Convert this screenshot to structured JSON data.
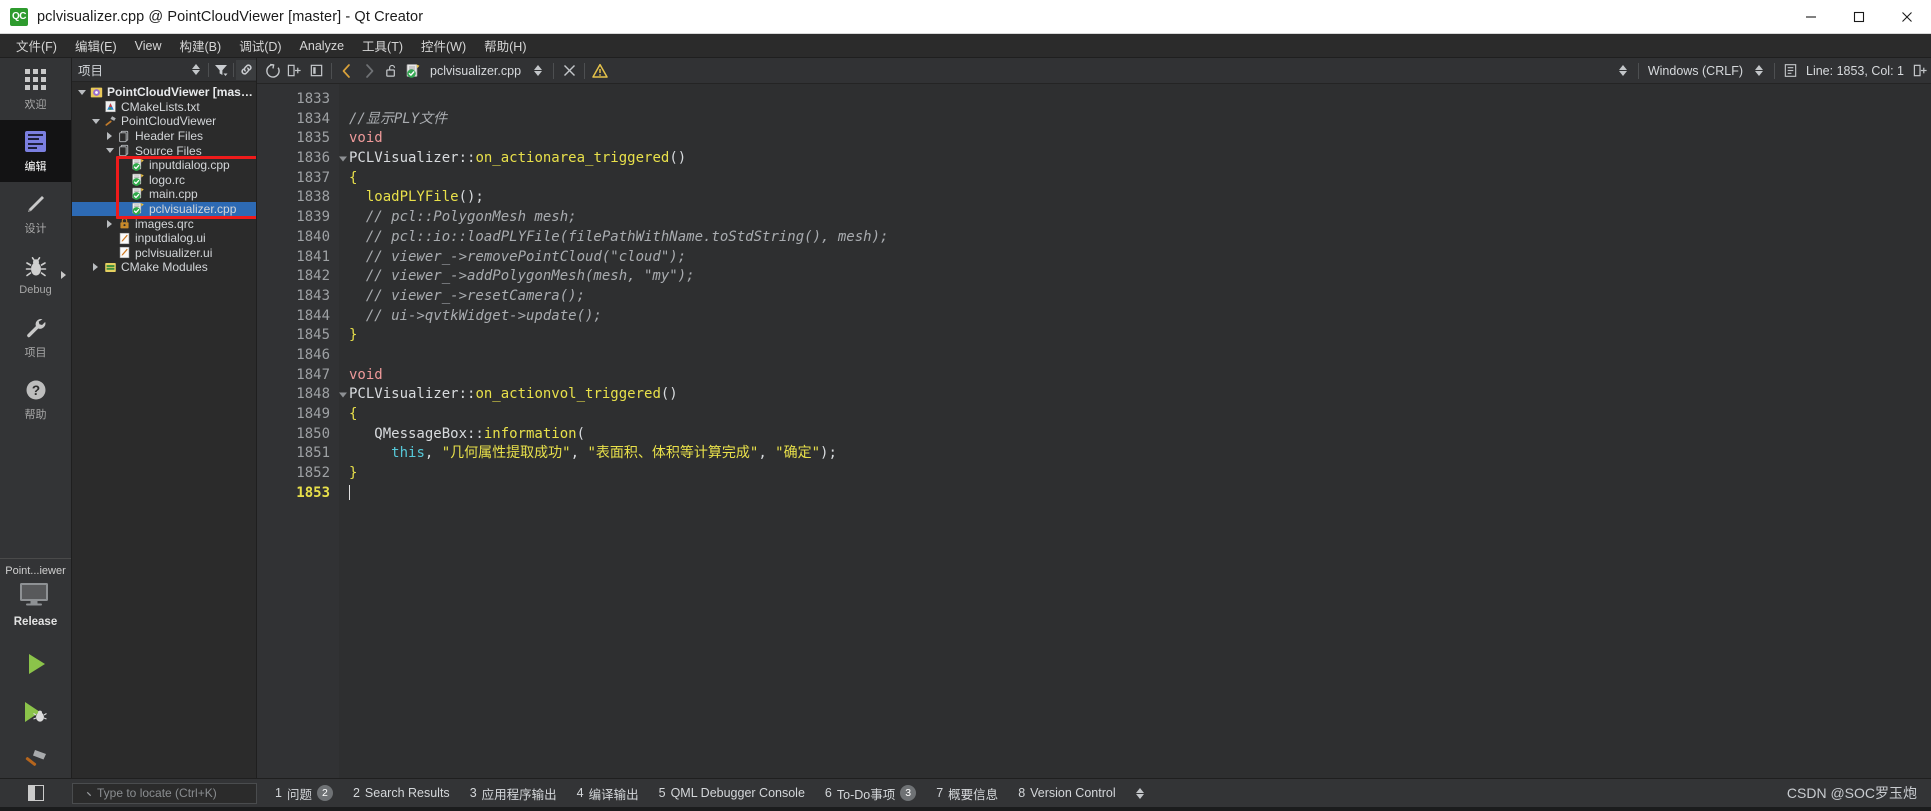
{
  "window": {
    "title": "pclvisualizer.cpp @ PointCloudViewer [master] - Qt Creator",
    "logo_text": "QC",
    "minimize_label": "Minimize",
    "maximize_label": "Maximize",
    "close_label": "Close"
  },
  "menubar": {
    "items": [
      {
        "label": "文件(F)"
      },
      {
        "label": "编辑(E)"
      },
      {
        "label": "View"
      },
      {
        "label": "构建(B)"
      },
      {
        "label": "调试(D)"
      },
      {
        "label": "Analyze"
      },
      {
        "label": "工具(T)"
      },
      {
        "label": "控件(W)"
      },
      {
        "label": "帮助(H)"
      }
    ]
  },
  "modebar": {
    "modes": [
      {
        "label": "欢迎",
        "icon": "grid-icon",
        "active": false,
        "has_arrow": false
      },
      {
        "label": "编辑",
        "icon": "edit-icon",
        "active": true,
        "has_arrow": false
      },
      {
        "label": "设计",
        "icon": "design-pencil-icon",
        "active": false,
        "has_arrow": false
      },
      {
        "label": "Debug",
        "icon": "bug-icon",
        "active": false,
        "has_arrow": true
      },
      {
        "label": "项目",
        "icon": "wrench-icon",
        "active": false,
        "has_arrow": false
      },
      {
        "label": "帮助",
        "icon": "question-icon",
        "active": false,
        "has_arrow": false
      }
    ],
    "kit": {
      "project_name": "Point...iewer",
      "build_config": "Release",
      "target_icon": "desktop-monitor-icon"
    },
    "run_buttons": [
      {
        "name": "run-button",
        "icon": "green-play-icon"
      },
      {
        "name": "debug-button",
        "icon": "green-play-bug-icon"
      },
      {
        "name": "build-button",
        "icon": "hammer-icon"
      }
    ]
  },
  "tree": {
    "header": {
      "title": "项目",
      "buttons": [
        "sort-updown-icon",
        "filter-icon",
        "link-sync-icon"
      ]
    },
    "items": [
      {
        "label": "PointCloudViewer [master]",
        "indent": 0,
        "twisty": "down",
        "icon": "project-gear-icon",
        "bold": true,
        "selected": false
      },
      {
        "label": "CMakeLists.txt",
        "indent": 1,
        "twisty": "none",
        "icon": "cmake-icon",
        "bold": false,
        "selected": false
      },
      {
        "label": "PointCloudViewer",
        "indent": 1,
        "twisty": "down",
        "icon": "build-target-icon",
        "bold": false,
        "selected": false
      },
      {
        "label": "Header Files",
        "indent": 2,
        "twisty": "right",
        "icon": "folder-files-icon",
        "bold": false,
        "selected": false
      },
      {
        "label": "Source Files",
        "indent": 2,
        "twisty": "down",
        "icon": "folder-files-icon",
        "bold": false,
        "selected": false
      },
      {
        "label": "inputdialog.cpp",
        "indent": 3,
        "twisty": "none",
        "icon": "cpp-file-icon",
        "bold": false,
        "selected": false
      },
      {
        "label": "logo.rc",
        "indent": 3,
        "twisty": "none",
        "icon": "cpp-file-icon",
        "bold": false,
        "selected": false
      },
      {
        "label": "main.cpp",
        "indent": 3,
        "twisty": "none",
        "icon": "cpp-file-icon",
        "bold": false,
        "selected": false
      },
      {
        "label": "pclvisualizer.cpp",
        "indent": 3,
        "twisty": "none",
        "icon": "cpp-file-icon",
        "bold": false,
        "selected": true
      },
      {
        "label": "images.qrc",
        "indent": 2,
        "twisty": "right",
        "icon": "qrc-icon",
        "bold": false,
        "selected": false
      },
      {
        "label": "inputdialog.ui",
        "indent": 2,
        "twisty": "none",
        "icon": "ui-file-icon",
        "bold": false,
        "selected": false
      },
      {
        "label": "pclvisualizer.ui",
        "indent": 2,
        "twisty": "none",
        "icon": "ui-file-icon",
        "bold": false,
        "selected": false
      },
      {
        "label": "CMake Modules",
        "indent": 1,
        "twisty": "right",
        "icon": "modules-icon",
        "bold": false,
        "selected": false
      }
    ],
    "annotation": {
      "color": "#ee1b1b",
      "shape": "rectangle"
    }
  },
  "editor_toolbar": {
    "back_label": "Back",
    "forward_label": "Forward",
    "lock_label": "Unlocked",
    "filename": "pclvisualizer.cpp",
    "close_label": "Close document",
    "warning_label": "Warnings",
    "line_ending": "Windows (CRLF)",
    "cursor_position": "Line: 1853, Col: 1",
    "split_label": "Split"
  },
  "code": {
    "first_line_number": 1833,
    "current_line": 1853,
    "fold_lines": [
      1836,
      1848
    ],
    "lines": [
      {
        "n": 1833,
        "tokens": []
      },
      {
        "n": 1834,
        "tokens": [
          {
            "t": "cmt",
            "s": "//显示PLY文件"
          }
        ]
      },
      {
        "n": 1835,
        "tokens": [
          {
            "t": "kw",
            "s": "void"
          }
        ]
      },
      {
        "n": 1836,
        "tokens": [
          {
            "t": "pln",
            "s": "PCLVisualizer::"
          },
          {
            "t": "fn",
            "s": "on_actionarea_triggered"
          },
          {
            "t": "pln",
            "s": "()"
          }
        ]
      },
      {
        "n": 1837,
        "tokens": [
          {
            "t": "fn",
            "s": "{"
          }
        ]
      },
      {
        "n": 1838,
        "tokens": [
          {
            "t": "pln",
            "s": "  "
          },
          {
            "t": "fn",
            "s": "loadPLYFile"
          },
          {
            "t": "pln",
            "s": "();"
          }
        ]
      },
      {
        "n": 1839,
        "tokens": [
          {
            "t": "pln",
            "s": "  "
          },
          {
            "t": "cmt",
            "s": "// pcl::PolygonMesh mesh;"
          }
        ]
      },
      {
        "n": 1840,
        "tokens": [
          {
            "t": "pln",
            "s": "  "
          },
          {
            "t": "cmt",
            "s": "// pcl::io::loadPLYFile(filePathWithName.toStdString(), mesh);"
          }
        ]
      },
      {
        "n": 1841,
        "tokens": [
          {
            "t": "pln",
            "s": "  "
          },
          {
            "t": "cmt",
            "s": "// viewer_->removePointCloud(\"cloud\");"
          }
        ]
      },
      {
        "n": 1842,
        "tokens": [
          {
            "t": "pln",
            "s": "  "
          },
          {
            "t": "cmt",
            "s": "// viewer_->addPolygonMesh(mesh, \"my\");"
          }
        ]
      },
      {
        "n": 1843,
        "tokens": [
          {
            "t": "pln",
            "s": "  "
          },
          {
            "t": "cmt",
            "s": "// viewer_->resetCamera();"
          }
        ]
      },
      {
        "n": 1844,
        "tokens": [
          {
            "t": "pln",
            "s": "  "
          },
          {
            "t": "cmt",
            "s": "// ui->qvtkWidget->update();"
          }
        ]
      },
      {
        "n": 1845,
        "tokens": [
          {
            "t": "fn",
            "s": "}"
          }
        ]
      },
      {
        "n": 1846,
        "tokens": []
      },
      {
        "n": 1847,
        "tokens": [
          {
            "t": "kw",
            "s": "void"
          }
        ]
      },
      {
        "n": 1848,
        "tokens": [
          {
            "t": "pln",
            "s": "PCLVisualizer::"
          },
          {
            "t": "fn",
            "s": "on_actionvol_triggered"
          },
          {
            "t": "pln",
            "s": "()"
          }
        ]
      },
      {
        "n": 1849,
        "tokens": [
          {
            "t": "fn",
            "s": "{"
          }
        ]
      },
      {
        "n": 1850,
        "tokens": [
          {
            "t": "pln",
            "s": "   QMessageBox::"
          },
          {
            "t": "fn",
            "s": "information"
          },
          {
            "t": "pln",
            "s": "("
          }
        ]
      },
      {
        "n": 1851,
        "tokens": [
          {
            "t": "pln",
            "s": "     "
          },
          {
            "t": "this",
            "s": "this"
          },
          {
            "t": "pln",
            "s": ", "
          },
          {
            "t": "str",
            "s": "\"几何属性提取成功\""
          },
          {
            "t": "pln",
            "s": ", "
          },
          {
            "t": "str",
            "s": "\"表面积、体积等计算完成\""
          },
          {
            "t": "pln",
            "s": ", "
          },
          {
            "t": "str",
            "s": "\"确定\""
          },
          {
            "t": "pln",
            "s": ");"
          }
        ]
      },
      {
        "n": 1852,
        "tokens": [
          {
            "t": "fn",
            "s": "}"
          }
        ]
      },
      {
        "n": 1853,
        "tokens": [],
        "caret": true
      }
    ]
  },
  "statusbar": {
    "sidebar_toggle_label": "Toggle sidebar",
    "search_placeholder": "Type to locate (Ctrl+K)",
    "panes": [
      {
        "num": "1",
        "label": "问题",
        "badge": "2"
      },
      {
        "num": "2",
        "label": "Search Results",
        "badge": ""
      },
      {
        "num": "3",
        "label": "应用程序输出",
        "badge": ""
      },
      {
        "num": "4",
        "label": "编译输出",
        "badge": ""
      },
      {
        "num": "5",
        "label": "QML Debugger Console",
        "badge": ""
      },
      {
        "num": "6",
        "label": "To-Do事项",
        "badge": "3"
      },
      {
        "num": "7",
        "label": "概要信息",
        "badge": ""
      },
      {
        "num": "8",
        "label": "Version Control",
        "badge": ""
      }
    ],
    "watermark": "CSDN @SOC罗玉炮"
  },
  "colors": {
    "accent_selection": "#2d6ab4",
    "annotation_red": "#ee1b1b",
    "current_line_number": "#e8e04a",
    "keyword": "#ef9a9a",
    "comment": "#a9acb0",
    "string": "#e8e04a",
    "function": "#e8e04a",
    "this_keyword": "#56c8d8",
    "editor_bg": "#2e2f30",
    "panel_bg": "#2b2b2b",
    "titlebar_bg": "#ffffff"
  }
}
